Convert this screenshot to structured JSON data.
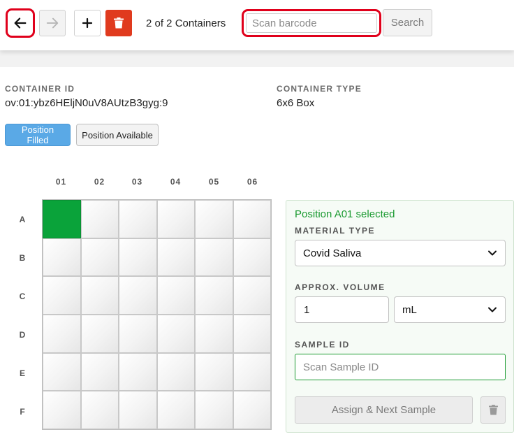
{
  "toolbar": {
    "container_count": "2 of 2 Containers",
    "scan_placeholder": "Scan barcode",
    "search_label": "Search",
    "icons": {
      "back": "arrow-left-icon",
      "forward": "arrow-right-icon",
      "add": "plus-icon",
      "delete": "trash-icon"
    }
  },
  "container": {
    "id_label": "CONTAINER ID",
    "id_value": "ov:01:ybz6HEljN0uV8AUtzB3gyg:9",
    "type_label": "CONTAINER TYPE",
    "type_value": "6x6 Box"
  },
  "legend": {
    "filled_label": "Position Filled",
    "available_label": "Position Available"
  },
  "grid": {
    "columns": [
      "01",
      "02",
      "03",
      "04",
      "05",
      "06"
    ],
    "rows": [
      "A",
      "B",
      "C",
      "D",
      "E",
      "F"
    ],
    "filled_positions": [
      "A01"
    ]
  },
  "panel": {
    "selected_text": "Position A01 selected",
    "material_label": "MATERIAL TYPE",
    "material_value": "Covid Saliva",
    "volume_label": "APPROX. VOLUME",
    "volume_value": "1",
    "volume_unit": "mL",
    "sample_label": "SAMPLE ID",
    "sample_placeholder": "Scan Sample ID",
    "assign_label": "Assign & Next Sample"
  },
  "colors": {
    "filled": "#0aa33a",
    "legend_filled": "#5aa9e6",
    "delete": "#e03a1e",
    "highlight": "#e0001b",
    "selected_text": "#1a9a30"
  }
}
